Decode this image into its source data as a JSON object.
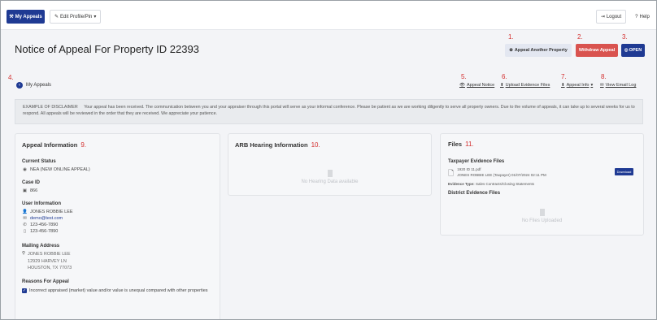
{
  "topbar": {
    "my_appeals": "My Appeals",
    "edit_profile": "Edit Profile/Pin",
    "logout": "Logout",
    "help": "Help"
  },
  "page": {
    "title": "Notice of Appeal For Property ID 22393"
  },
  "markers": [
    "1.",
    "2.",
    "3.",
    "4.",
    "5.",
    "6.",
    "7.",
    "8.",
    "9.",
    "10.",
    "11."
  ],
  "buttons": {
    "appeal_another": "Appeal Another Property",
    "withdraw": "Withdraw Appeal",
    "open": "OPEN"
  },
  "nav": {
    "back": "My Appeals",
    "appeal_notice": "Appeal Notice",
    "upload_evidence": "Upload Evidence Files",
    "appeal_info": "Appeal Info",
    "view_email_log": "View Email Log"
  },
  "disclaimer": {
    "label": "EXAMPLE OF DISCLAIMER",
    "text": "Your appeal has been received. The communication between you and your appraiser through this portal will serve as your informal conference. Please be patient as we are working diligently to serve all property owners. Due to the volume of appeals, it can take up to several weeks for us to respond. All appeals will be reviewed in the order that they are received. We appreciate your patience."
  },
  "appeal_info": {
    "title": "Appeal Information",
    "current_status_label": "Current Status",
    "current_status": "NEA (NEW ONLINE APPEAL)",
    "case_id_label": "Case ID",
    "case_id": "866",
    "user_info_label": "User Information",
    "user_name": "JONES ROBBIE LEE",
    "user_email": "demo@test.com",
    "phone_1": "123-456-7890",
    "phone_2": "123-456-7890",
    "mailing_label": "Mailing Address",
    "mailing_name": "JONES ROBBIE LEE",
    "mailing_street": "12929 HARVEY LN",
    "mailing_city": "HOUSTON, TX 77073",
    "reasons_label": "Reasons For Appeal",
    "reason_1": "Incorrect appraised (market) value and/or value is unequal compared with other properties"
  },
  "arb": {
    "title": "ARB Hearing Information",
    "empty": "No Hearing Data available"
  },
  "files": {
    "title": "Files",
    "taxpayer_label": "Taxpayer Evidence Files",
    "file_name": "1920 ID 11.pdf",
    "file_meta": "JONES ROBBIE LEE (Taxpayer) 01/07/2024 02:11 PM",
    "evidence_type_label": "Evidence Type:",
    "evidence_type": "Sales Contracts/Closing Statements",
    "download": "Download",
    "district_label": "District Evidence Files",
    "empty": "No Files Uploaded"
  }
}
